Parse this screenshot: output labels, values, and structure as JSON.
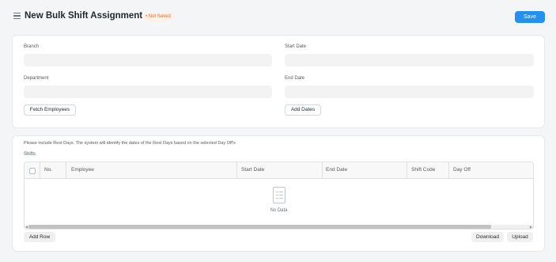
{
  "header": {
    "title": "New Bulk Shift Assignment",
    "status_badge": "• Not Saved",
    "save_label": "Save"
  },
  "form": {
    "branch_label": "Branch",
    "start_date_label": "Start Date",
    "department_label": "Department",
    "end_date_label": "End Date",
    "branch_value": "",
    "start_date_value": "",
    "department_value": "",
    "end_date_value": "",
    "fetch_employees_label": "Fetch Employees",
    "add_dates_label": "Add Dates"
  },
  "shifts_section": {
    "note": "Please include Rest Days. The system will identify the dates of the Rest Days based on the selected Day Off's",
    "label": "Shifts",
    "columns": [
      "No.",
      "Employee",
      "Start Date",
      "End Date",
      "Shift Code",
      "Day Off"
    ],
    "rows": [],
    "empty_text": "No Data",
    "add_row_label": "Add Row",
    "download_label": "Download",
    "upload_label": "Upload"
  },
  "colors": {
    "accent": "#2490ef",
    "badge_text": "#e86c13",
    "badge_bg": "#fff1e7",
    "page_bg": "#f4f5f6"
  },
  "icons": [
    "menu-icon",
    "no-data-icon",
    "checkbox-icon"
  ]
}
